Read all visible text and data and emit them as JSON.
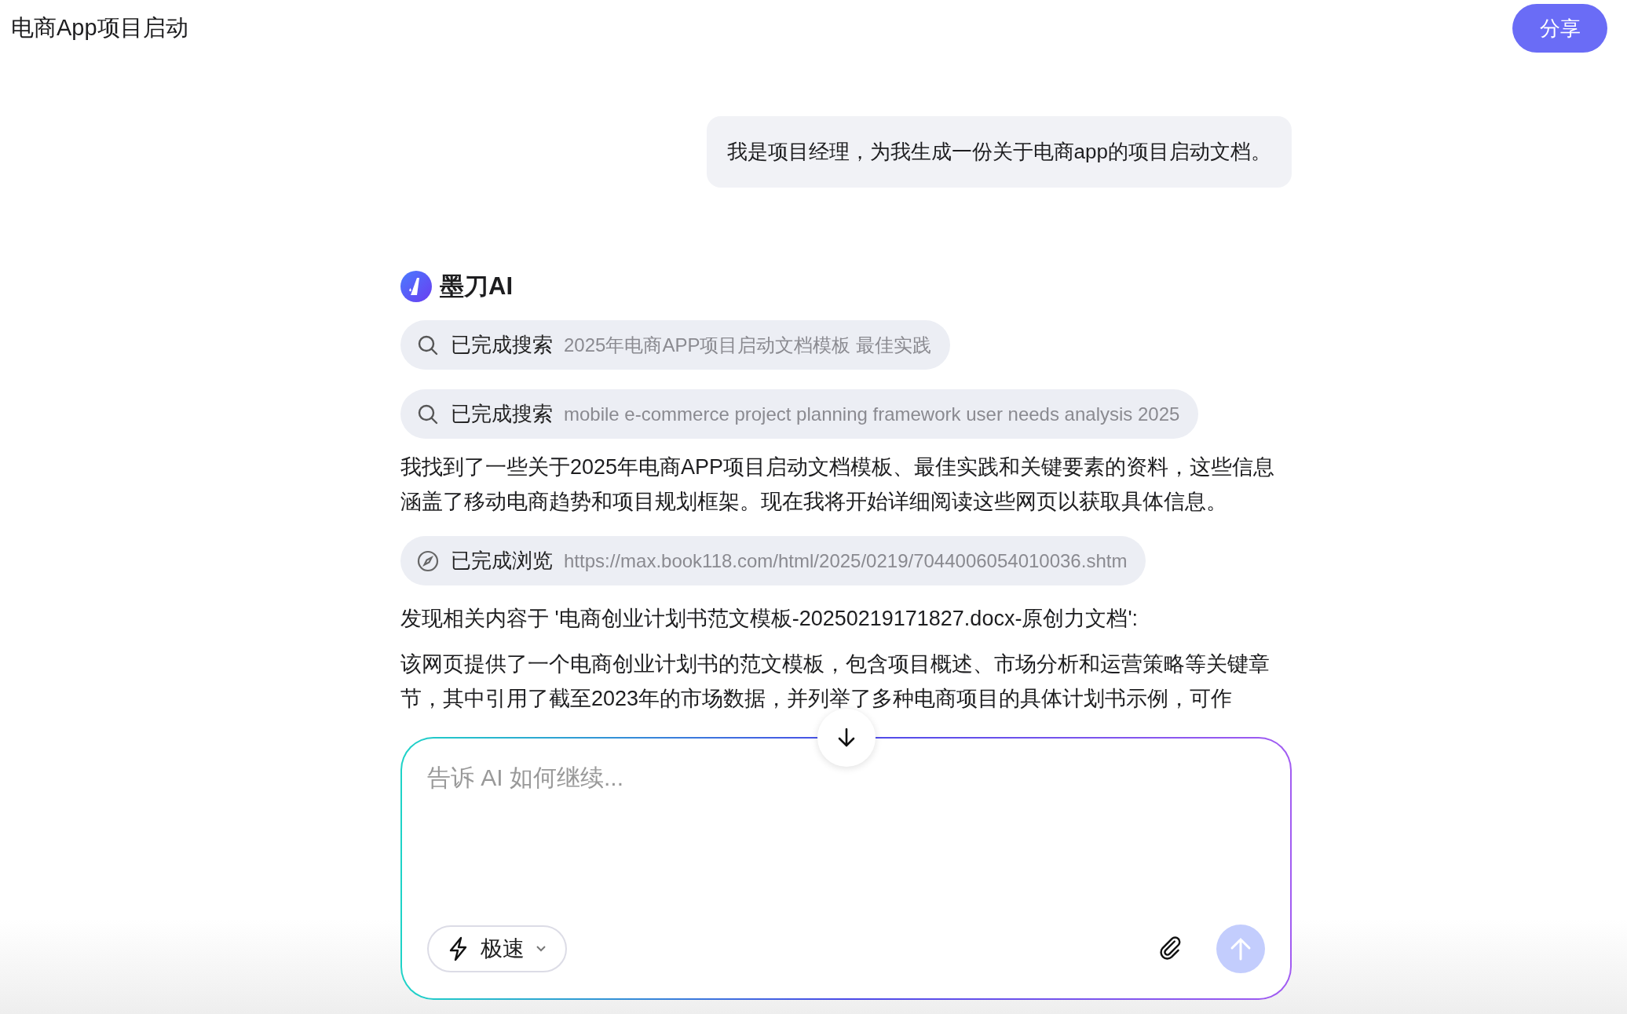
{
  "header": {
    "title": "电商App项目启动",
    "share_button": "分享"
  },
  "user_message": "我是项目经理，为我生成一份关于电商app的项目启动文档。",
  "assistant": {
    "name": "墨刀AI",
    "blocks": [
      {
        "kind": "search",
        "label": "已完成搜索",
        "detail": "2025年电商APP项目启动文档模板 最佳实践"
      },
      {
        "kind": "search",
        "label": "已完成搜索",
        "detail": "mobile e-commerce project planning framework user needs analysis 2025"
      },
      {
        "kind": "text",
        "text": "我找到了一些关于2025年电商APP项目启动文档模板、最佳实践和关键要素的资料，这些信息涵盖了移动电商趋势和项目规划框架。现在我将开始详细阅读这些网页以获取具体信息。"
      },
      {
        "kind": "browse",
        "label": "已完成浏览",
        "detail": "https://max.book118.com/html/2025/0219/7044006054010036.shtm"
      },
      {
        "kind": "text",
        "text": "发现相关内容于 '电商创业计划书范文模板-20250219171827.docx-原创力文档':"
      },
      {
        "kind": "text",
        "text": "该网页提供了一个电商创业计划书的范文模板，包含项目概述、市场分析和运营策略等关键章节，其中引用了截至2023年的市场数据，并列举了多种电商项目的具体计划书示例，可作"
      }
    ]
  },
  "composer": {
    "placeholder": "告诉 AI 如何继续...",
    "mode": "极速",
    "send_disabled": true
  }
}
